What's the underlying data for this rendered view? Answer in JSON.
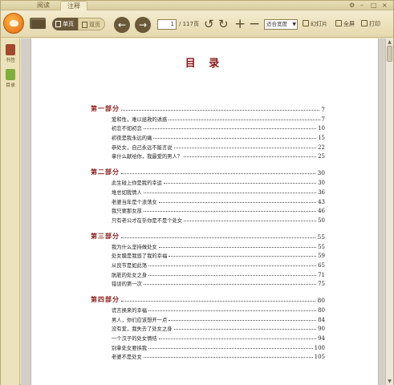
{
  "tabs": [
    {
      "label": "阅读"
    },
    {
      "label": "注释"
    }
  ],
  "window_controls": [
    "⚙",
    "–",
    "□",
    "×"
  ],
  "toolbar": {
    "single_page_label": "单页",
    "double_page_label": "双页",
    "page_current": "1",
    "page_total": "/ 117页",
    "zoom_value": "适合宽度",
    "slideshow_label": "幻灯片",
    "fullscreen_label": "全屏",
    "print_label": "打印"
  },
  "sidebar": {
    "bookmark_label": "书签",
    "toc_label": "目录"
  },
  "document": {
    "title": "目 录",
    "parts": [
      {
        "title": "第一部分",
        "page": "7",
        "entries": [
          {
            "title": "爱和性，难以拯救的诱惑",
            "page": "7"
          },
          {
            "title": "初恋不如初恋",
            "page": "10"
          },
          {
            "title": "初夜是我永远的痛",
            "page": "15"
          },
          {
            "title": "恭处女，自己永远不能言说",
            "page": "22"
          },
          {
            "title": "拿什么献给你，我最爱的男人？",
            "page": "25"
          }
        ]
      },
      {
        "title": "第二部分",
        "page": "30",
        "entries": [
          {
            "title": "此生碰上你是我的幸运",
            "page": "30"
          },
          {
            "title": "堆总如我情人",
            "page": "36"
          },
          {
            "title": "老婆当年是个浪荡女",
            "page": "43"
          },
          {
            "title": "我只要那女孩",
            "page": "46"
          },
          {
            "title": "只有老公才在乎你是不是个处女",
            "page": "50"
          }
        ]
      },
      {
        "title": "第三部分",
        "page": "55",
        "entries": [
          {
            "title": "我为什么坚持做处女",
            "page": "55"
          },
          {
            "title": "处女膜是我毁了我的幸福",
            "page": "59"
          },
          {
            "title": "从良节是如此荡",
            "page": "65"
          },
          {
            "title": "肮脏的处女之身",
            "page": "71"
          },
          {
            "title": "错误的第一次",
            "page": "75"
          }
        ]
      },
      {
        "title": "第四部分",
        "page": "80",
        "entries": [
          {
            "title": "谎言换来的幸福",
            "page": "80"
          },
          {
            "title": "男人，你们应该想开一点",
            "page": "84"
          },
          {
            "title": "没有爱，我失去了处女之身",
            "page": "90"
          },
          {
            "title": "一个汉子的处女情结",
            "page": "94"
          },
          {
            "title": "别拿处女要挟我",
            "page": "100"
          },
          {
            "title": "老婆不是处女",
            "page": "105"
          }
        ]
      }
    ]
  }
}
